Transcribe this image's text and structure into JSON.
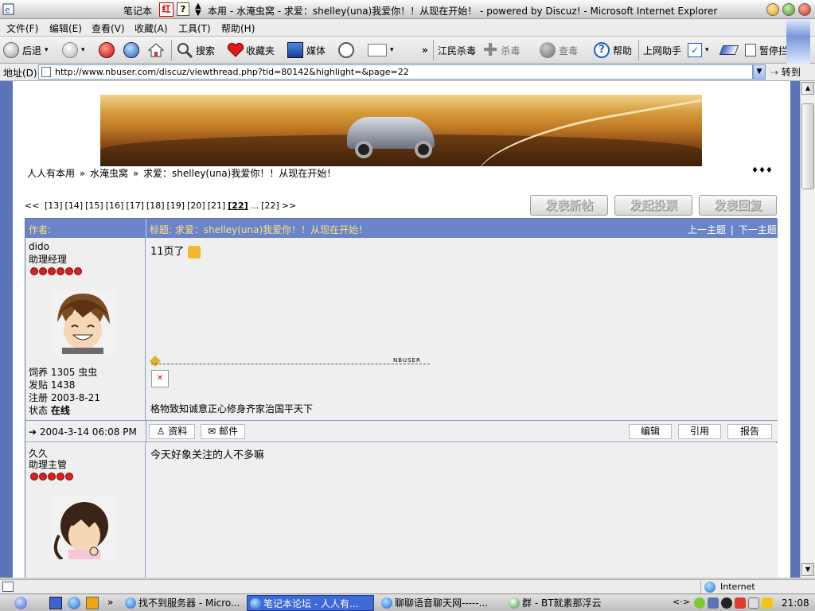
{
  "window": {
    "title": "本用 - 水淹虫窝 - 求爱：shelley(una)我爱你！！从现在开始！ - powered by Discuz! - Microsoft Internet Explorer",
    "title_prefix": "笔记本",
    "red_icon_text": "红"
  },
  "menu": [
    "文件(F)",
    "编辑(E)",
    "查看(V)",
    "收藏(A)",
    "工具(T)",
    "帮助(H)"
  ],
  "toolbar": {
    "back": "后退",
    "search": "搜索",
    "favorites": "收藏夹",
    "media": "媒体",
    "more": "»",
    "jiangmin": "江民杀毒",
    "kill": "杀毒",
    "scan": "查毒",
    "help": "帮助",
    "assistant": "上网助手",
    "pause": "暂停拦截"
  },
  "address": {
    "label": "地址(D)",
    "url": "http://www.nbuser.com/discuz/viewthread.php?tid=80142&highlight=&page=22",
    "go": "转到"
  },
  "breadcrumb": {
    "site": "人人有本用",
    "sep1": "»",
    "forum": "水淹虫窝",
    "sep2": "»",
    "thread": "求爱：shelley(una)我爱你！！从现在开始！",
    "dots": "♦♦♦"
  },
  "pager": {
    "first": "<<",
    "pages": [
      "[13]",
      "[14]",
      "[15]",
      "[16]",
      "[17]",
      "[18]",
      "[19]",
      "[20]",
      "[21]"
    ],
    "current": "[22]",
    "ellipsis": "...",
    "last": "[22]",
    "next": ">>"
  },
  "action_buttons": {
    "new_thread": "发表新帖",
    "new_poll": "发起投票",
    "reply": "发表回复"
  },
  "table_header": {
    "author": "作者:",
    "title": "标题: 求爱：shelley(una)我爱你！！从现在开始！",
    "prev": "上一主题",
    "sep": "|",
    "next": "下一主题"
  },
  "posts": [
    {
      "username": "dido",
      "rank": "助理经理",
      "stats": [
        {
          "label": "饲养",
          "value": "1305 虫虫"
        },
        {
          "label": "发贴",
          "value": "1438"
        },
        {
          "label": "注册",
          "value": "2003-8-21"
        },
        {
          "label": "状态",
          "value": "在线"
        }
      ],
      "message": "11页了",
      "signature_label": "NBUSER",
      "signature": "格物致知诚意正心修身齐家治国平天下",
      "footer": {
        "date": "2004-3-14 06:08 PM",
        "profile": "资料",
        "email": "邮件",
        "edit": "编辑",
        "quote": "引用",
        "report": "报告"
      }
    },
    {
      "username": "久久",
      "rank": "助理主管",
      "message": "今天好象关注的人不多嘛"
    }
  ],
  "statusbar": {
    "zone": "Internet"
  },
  "taskbar": {
    "tasks": [
      "找不到服务器 - Micro...",
      "笔记本论坛 - 人人有...",
      "聊聊语音聊天网-----...",
      "群 - BT就素那浮云"
    ],
    "clock": "21:08",
    "arrows": "»",
    "tray_arrows": "<·>"
  }
}
